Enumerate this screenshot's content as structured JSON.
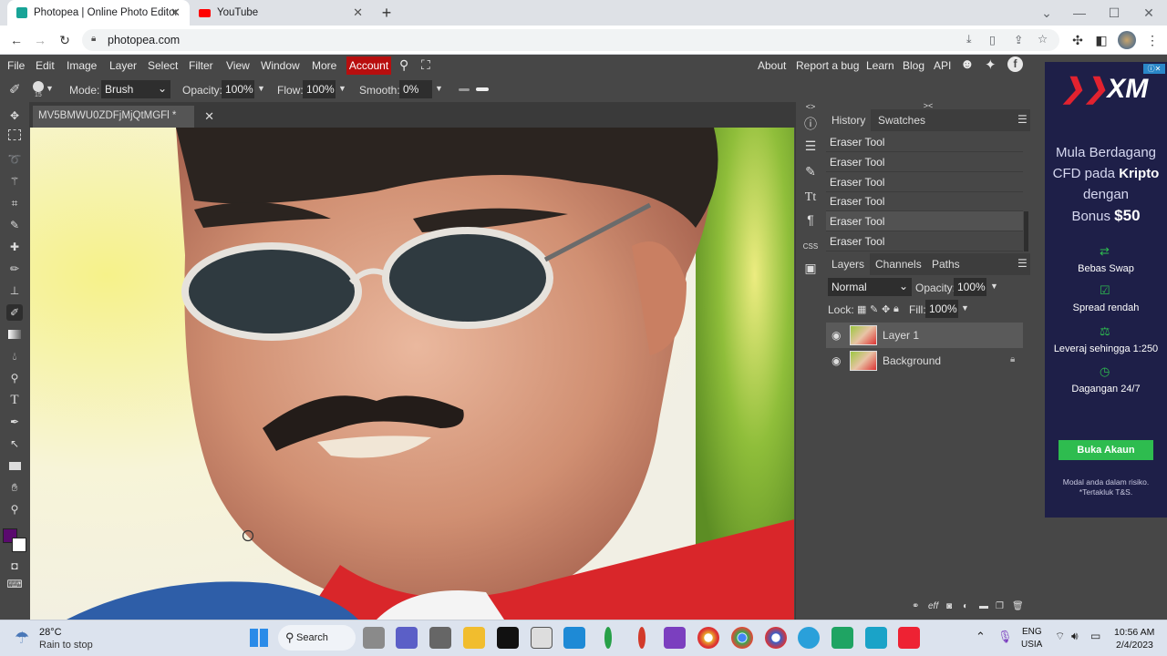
{
  "browser": {
    "tabs": [
      {
        "title": "Photopea | Online Photo Editor"
      },
      {
        "title": "YouTube"
      }
    ],
    "url": "photopea.com"
  },
  "menu": {
    "items": [
      "File",
      "Edit",
      "Image",
      "Layer",
      "Select",
      "Filter",
      "View",
      "Window",
      "More"
    ],
    "account": "Account",
    "right": [
      "About",
      "Report a bug",
      "Learn",
      "Blog",
      "API"
    ]
  },
  "options": {
    "mode_label": "Mode:",
    "mode_value": "Brush",
    "brush_size": "15",
    "opacity_label": "Opacity:",
    "opacity_value": "100%",
    "flow_label": "Flow:",
    "flow_value": "100%",
    "smooth_label": "Smooth:",
    "smooth_value": "0%"
  },
  "document": {
    "tab_title": "MV5BMWU0ZDFjMjQtMGFl *"
  },
  "history": {
    "tabs": [
      "History",
      "Swatches"
    ],
    "items": [
      "Eraser Tool",
      "Eraser Tool",
      "Eraser Tool",
      "Eraser Tool",
      "Eraser Tool",
      "Eraser Tool"
    ]
  },
  "layers": {
    "tabs": [
      "Layers",
      "Channels",
      "Paths"
    ],
    "blend": "Normal",
    "opacity_label": "Opacity:",
    "opacity_value": "100%",
    "lock_label": "Lock:",
    "fill_label": "Fill:",
    "fill_value": "100%",
    "items": [
      {
        "name": "Layer 1"
      },
      {
        "name": "Background"
      }
    ],
    "footer": "eff"
  },
  "ad": {
    "brand": "XM",
    "headline": "Mula Berdagang CFD pada",
    "highlight": "Kripto",
    "line3": "dengan",
    "bonus_pre": "Bonus",
    "bonus_amt": "$50",
    "features": [
      "Bebas Swap",
      "Spread rendah",
      "Leveraj sehingga 1:250",
      "Dagangan 24/7"
    ],
    "cta": "Buka Akaun",
    "disclaimer": "Modal anda dalam risiko. *Tertakluk T&S."
  },
  "taskbar": {
    "weather_temp": "28°C",
    "weather_desc": "Rain to stop",
    "search": "Search",
    "lang1": "ENG",
    "lang2": "USIA",
    "time": "10:56 AM",
    "date": "2/4/2023"
  },
  "colors": {
    "accent": "#b80e0e",
    "fg_color": "#5a0a6e",
    "ad_green": "#2ebc4f"
  }
}
